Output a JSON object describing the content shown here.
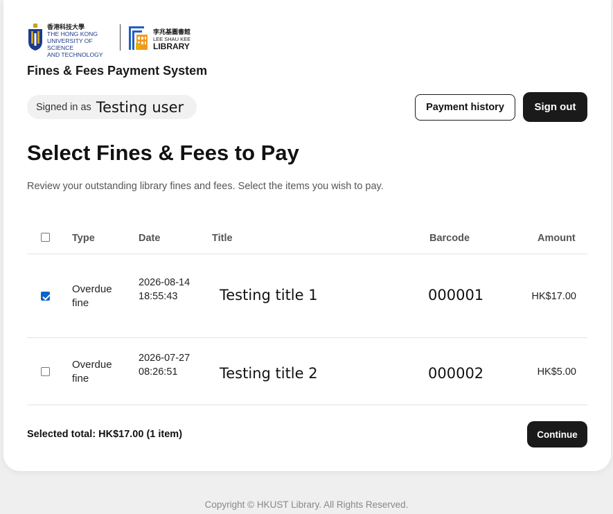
{
  "header": {
    "hkust_logo": {
      "zh": "香港科技大學",
      "line1": "THE HONG KONG",
      "line2": "UNIVERSITY OF SCIENCE",
      "line3": "AND TECHNOLOGY"
    },
    "library_logo": {
      "zh": "李兆基圖書館",
      "line1": "LEE SHAU KEE",
      "line2": "LIBRARY"
    },
    "system_title": "Fines & Fees Payment System",
    "signed_in_label": "Signed in as",
    "user_name": "Testing user",
    "payment_history_label": "Payment history",
    "sign_out_label": "Sign out"
  },
  "main": {
    "title": "Select Fines & Fees to Pay",
    "description": "Review your outstanding library fines and fees. Select the items you wish to pay.",
    "columns": [
      "Type",
      "Date",
      "Title",
      "Barcode",
      "Amount"
    ],
    "rows": [
      {
        "checked": true,
        "type": "Overdue fine",
        "date": "2026-08-14 18:55:43",
        "title": "Testing title 1",
        "barcode": "000001",
        "amount": "HK$17.00"
      },
      {
        "checked": false,
        "type": "Overdue fine",
        "date": "2026-07-27 08:26:51",
        "title": "Testing title 2",
        "barcode": "000002",
        "amount": "HK$5.00"
      }
    ],
    "selected_total": "Selected total: HK$17.00 (1 item)",
    "continue_label": "Continue"
  },
  "footer": {
    "copyright": "Copyright © HKUST Library. All Rights Reserved."
  },
  "colors": {
    "primary_dark": "#1a1a1a",
    "checkbox_checked": "#0b63ce",
    "hkust_blue": "#1f3a8a",
    "hkust_gold": "#c9a227",
    "library_orange": "#f29a1f"
  }
}
